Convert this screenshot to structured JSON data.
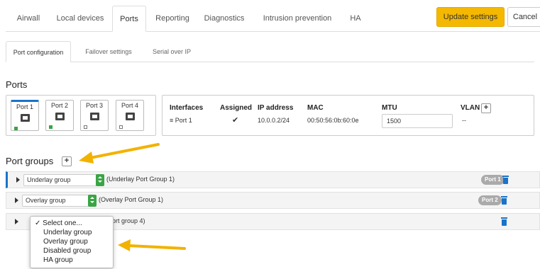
{
  "top_tabs": [
    {
      "label": "Airwall",
      "active": false
    },
    {
      "label": "Local devices",
      "active": false
    },
    {
      "label": "Ports",
      "active": true
    },
    {
      "label": "Reporting",
      "active": false
    },
    {
      "label": "Diagnostics",
      "active": false
    },
    {
      "label": "Intrusion prevention",
      "active": false
    },
    {
      "label": "HA",
      "active": false
    }
  ],
  "actions": {
    "update_label": "Update settings",
    "cancel_label": "Cancel"
  },
  "sub_tabs": [
    {
      "label": "Port configuration",
      "active": true
    },
    {
      "label": "Failover settings",
      "active": false
    },
    {
      "label": "Serial over IP",
      "active": false
    }
  ],
  "ports_section": {
    "title": "Ports",
    "ports": [
      {
        "label": "Port 1",
        "link": "up",
        "selected": true
      },
      {
        "label": "Port 2",
        "link": "up",
        "selected": false
      },
      {
        "label": "Port 3",
        "link": "down",
        "selected": false
      },
      {
        "label": "Port 4",
        "link": "down",
        "selected": false
      }
    ]
  },
  "interfaces_table": {
    "headers": {
      "interfaces": "Interfaces",
      "assigned": "Assigned",
      "ip": "IP address",
      "mac": "MAC",
      "mtu": "MTU",
      "vlan": "VLAN"
    },
    "row": {
      "interface": "≡ Port 1",
      "assigned": "✔",
      "ip": "10.0.0.2/24",
      "mac": "00:50:56:0b:60:0e",
      "mtu": "1500",
      "vlan": "--"
    },
    "add_vlan": "+"
  },
  "port_groups": {
    "title": "Port groups",
    "add_label": "+",
    "groups": [
      {
        "select_value": "Underlay group",
        "description": "(Underlay Port Group 1)",
        "badge": "Port 1"
      },
      {
        "select_value": "Overlay group",
        "description": "(Overlay Port Group 1)",
        "badge": "Port 2"
      },
      {
        "select_value": "",
        "description": "ort group 4)",
        "badge": ""
      }
    ]
  },
  "dropdown_options": [
    "✓ Select one...",
    "Underlay group",
    "Overlay group",
    "Disabled group",
    "HA group"
  ],
  "colors": {
    "accent": "#1a73c9",
    "primary_button": "#f5b800",
    "link_up": "#3aa544",
    "select_arrow": "#3aa544",
    "callout_arrow": "#f2b200"
  }
}
